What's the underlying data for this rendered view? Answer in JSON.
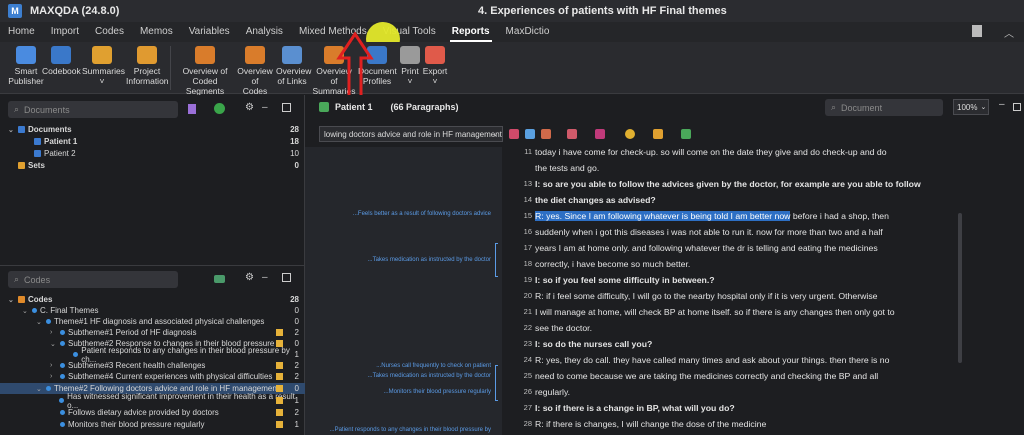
{
  "app": {
    "title": "MAXQDA (24.8.0)",
    "document_title": "4. Experiences of patients with HF Final themes",
    "logo": "M"
  },
  "menu": [
    {
      "label": "Home"
    },
    {
      "label": "Import"
    },
    {
      "label": "Codes"
    },
    {
      "label": "Memos"
    },
    {
      "label": "Variables"
    },
    {
      "label": "Analysis"
    },
    {
      "label": "Mixed Methods"
    },
    {
      "label": "Visual Tools"
    },
    {
      "label": "Reports"
    },
    {
      "label": "MaxDictio"
    }
  ],
  "ribbon": [
    {
      "label": "Smart\nPublisher",
      "color": "#4a8be0"
    },
    {
      "label": "Codebook",
      "color": "#3a78c9"
    },
    {
      "label": "Summaries\n˅",
      "color": "#e0a030"
    },
    {
      "label": "Project\nInformation",
      "color": "#e09a30"
    },
    {
      "label": "Overview of Coded\nSegments",
      "color": "#d97c2b"
    },
    {
      "label": "Overview of\nCodes",
      "color": "#d97c2b"
    },
    {
      "label": "Overview\nof Links",
      "color": "#5a8fd0"
    },
    {
      "label": "Overview of\nSummaries",
      "color": "#d97c2b"
    },
    {
      "label": "Document\nProfiles",
      "color": "#3a78c9"
    },
    {
      "label": "Print\n˅",
      "color": "#9a9a9a"
    },
    {
      "label": "Export\n˅",
      "color": "#e05a4a"
    }
  ],
  "documents_panel": {
    "search_placeholder": "Documents",
    "rows": [
      {
        "label": "Documents",
        "count": "28"
      },
      {
        "label": "Patient 1",
        "count": "18"
      },
      {
        "label": "Patient 2",
        "count": "10"
      },
      {
        "label": "Sets",
        "count": "0"
      }
    ]
  },
  "codes_panel": {
    "search_placeholder": "Codes",
    "rows": [
      {
        "label": "Codes",
        "count": "28"
      },
      {
        "label": "C. Final Themes",
        "count": "0"
      },
      {
        "label": "Theme#1 HF diagnosis and associated physical challenges",
        "count": "0"
      },
      {
        "label": "Subtheme#1 Period of HF diagnosis",
        "count": "2"
      },
      {
        "label": "Subtheme#2 Response to changes in their blood pressure",
        "count": "0"
      },
      {
        "label": "Patient responds to any changes in their blood pressure by ch...",
        "count": "1"
      },
      {
        "label": "Subtheme#3 Recent health challenges",
        "count": "2"
      },
      {
        "label": "Subtheme#4 Current experiences with physical difficulties",
        "count": "2"
      },
      {
        "label": "Theme#2 Following doctors advice and role in HF management",
        "count": "0"
      },
      {
        "label": "Has witnessed significant improvement in their health as a result o...",
        "count": "1"
      },
      {
        "label": "Follows dietary advice provided by doctors",
        "count": "2"
      },
      {
        "label": "Monitors their blood pressure regularly",
        "count": "1"
      }
    ]
  },
  "document_view": {
    "title": "Patient 1",
    "paragraphs": "(66 Paragraphs)",
    "search_placeholder": "Document",
    "zoom": "100%",
    "code_dropdown": "lowing doctors advice and role in HF management",
    "code_markers": [
      "...Feels better as a result of following doctors advice",
      "...Takes medication as instructed by the doctor",
      "...Nurses call frequently to check on patient",
      "...Takes medication as instructed by the doctor",
      "...Monitors their blood pressure regularly",
      "...Patient responds to any changes in their blood pressure by"
    ],
    "lines": [
      {
        "n": "11",
        "text": "today i have come for check-up. so will come on the date they give and do check-up and do"
      },
      {
        "n": "",
        "text": "the tests and go."
      },
      {
        "n": "13",
        "text": "I: so are you able to follow the advices given by the doctor, for example are you able to follow"
      },
      {
        "n": "14",
        "text": "the diet changes as advised?"
      },
      {
        "n": "15",
        "hl": "R: yes. Since I am following whatever is being told I am better now",
        "text": " before i had a shop, then"
      },
      {
        "n": "16",
        "text": "suddenly when i got this diseases i was not able to run it. now for more than two and a half"
      },
      {
        "n": "17",
        "text": "years I am at home only. and following whatever the dr is telling and eating the medicines"
      },
      {
        "n": "18",
        "text": "correctly, i have become so much better."
      },
      {
        "n": "19",
        "text": "I: so if you feel some difficulty in between.?"
      },
      {
        "n": "20",
        "text": "R: if i feel some difficulty, I will go to the nearby hospital only if it is very urgent. Otherwise"
      },
      {
        "n": "21",
        "text": "I will manage at home, will check BP at home itself. so if there is any changes then only got to"
      },
      {
        "n": "22",
        "text": "see the doctor."
      },
      {
        "n": "23",
        "text": "I: so do the nurses call you?"
      },
      {
        "n": "24",
        "text": "R: yes, they do call. they have called many times and ask about your things. then there is no"
      },
      {
        "n": "25",
        "text": "need to come because we are taking the medicines correctly and checking the BP and all"
      },
      {
        "n": "26",
        "text": "regularly."
      },
      {
        "n": "27",
        "text": "I: so if there is a change in BP, what will you do?"
      },
      {
        "n": "28",
        "text": "R: if there is changes, I will change the dose of the medicine"
      }
    ]
  }
}
